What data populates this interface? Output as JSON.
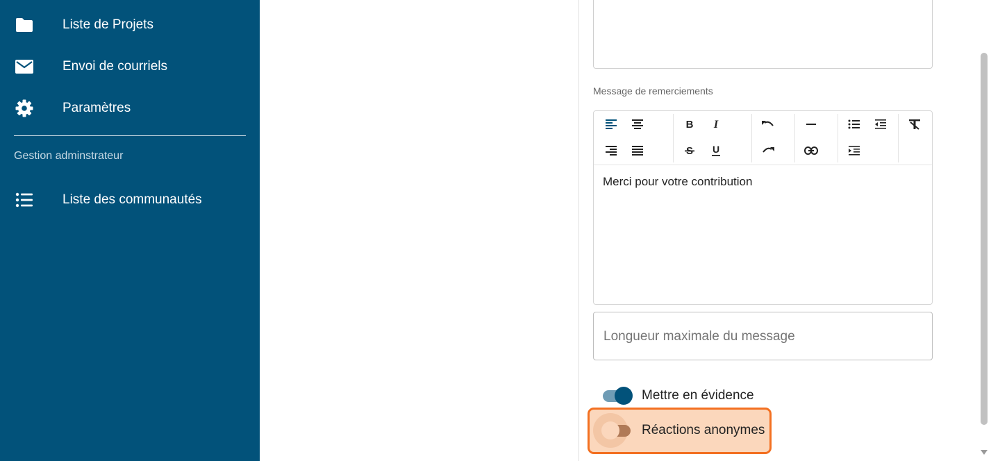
{
  "sidebar": {
    "items": [
      {
        "label": "Liste de Projets",
        "icon": "folder-icon"
      },
      {
        "label": "Envoi de courriels",
        "icon": "mail-icon"
      },
      {
        "label": "Paramètres",
        "icon": "gear-icon"
      }
    ],
    "section_label": "Gestion adminstrateur",
    "admin_items": [
      {
        "label": "Liste des communautés",
        "icon": "list-icon"
      }
    ],
    "background": "#02527a"
  },
  "form": {
    "thanks_label": "Message de remerciements",
    "editor_content": "Merci pour votre contribution",
    "max_length_placeholder": "Longueur maximale du message",
    "toggles": [
      {
        "label": "Mettre en évidence",
        "checked": true
      },
      {
        "label": "Réactions anonymes",
        "checked": false,
        "highlighted": true
      }
    ]
  },
  "toolbar": {
    "buttons": [
      "align-left-icon",
      "align-center-icon",
      "align-right-icon",
      "align-justify-icon",
      "bold-icon",
      "italic-icon",
      "strikethrough-icon",
      "underline-icon",
      "undo-icon",
      "redo-icon",
      "horizontal-rule-icon",
      "link-icon",
      "bullet-list-icon",
      "outdent-icon",
      "indent-icon",
      "clear-format-icon"
    ]
  },
  "colors": {
    "accent": "#02527a",
    "highlight_border": "#f37021",
    "toggle_track_on": "#6f9cb5"
  }
}
